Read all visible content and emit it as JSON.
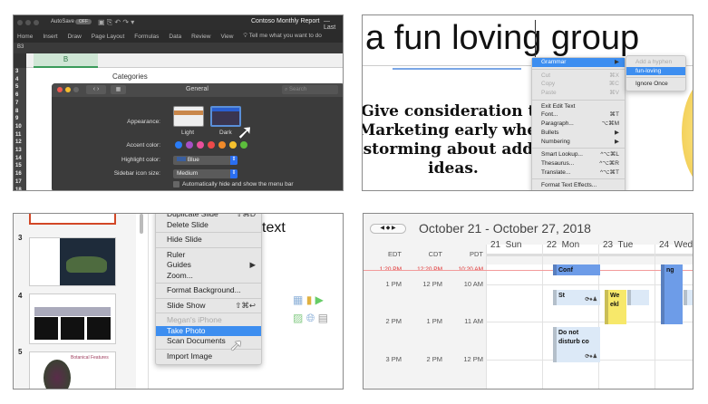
{
  "excel": {
    "autosave": "AutoSave",
    "autosave_state": "OFF",
    "doc_title": "Contoso Monthly Report",
    "last": "— Last",
    "tabs": [
      "Home",
      "Insert",
      "Draw",
      "Page Layout",
      "Formulas",
      "Data",
      "Review",
      "View"
    ],
    "tell_me": "Tell me what you want to do",
    "cell_ref": "B3",
    "column": "B",
    "rows": [
      "3",
      "4",
      "5",
      "6",
      "7",
      "8",
      "9",
      "10",
      "11",
      "12",
      "13",
      "14",
      "15",
      "16",
      "17",
      "18"
    ],
    "categories": "Categories"
  },
  "prefs": {
    "title": "General",
    "search_placeholder": "Search",
    "appearance_label": "Appearance:",
    "light": "Light",
    "dark": "Dark",
    "accent_label": "Accent color:",
    "accent_colors": [
      "#2a7cf6",
      "#a550c5",
      "#e8509b",
      "#ec4a4a",
      "#f08a2a",
      "#f5c02e",
      "#5cbd3c"
    ],
    "highlight_label": "Highlight color:",
    "highlight_value": "Blue",
    "sidebar_label": "Sidebar icon size:",
    "sidebar_value": "Medium",
    "menubar_option": "Automatically hide and show the menu bar"
  },
  "word": {
    "heading": "a fun loving group",
    "body_lines": [
      "Give consideration to",
      "Marketing early when",
      "brainstorming about additional",
      "ideas."
    ],
    "menu": [
      {
        "label": "Grammar",
        "shortcut": "▶",
        "state": "highlight"
      },
      {
        "sep": true
      },
      {
        "label": "Cut",
        "shortcut": "⌘X",
        "state": "disabled"
      },
      {
        "label": "Copy",
        "shortcut": "⌘C",
        "state": "disabled"
      },
      {
        "label": "Paste",
        "shortcut": "⌘V",
        "state": "disabled"
      },
      {
        "sep": true
      },
      {
        "label": "Exit Edit Text",
        "shortcut": ""
      },
      {
        "label": "Font...",
        "shortcut": "⌘T"
      },
      {
        "label": "Paragraph...",
        "shortcut": "⌥⌘M"
      },
      {
        "label": "Bullets",
        "shortcut": "▶"
      },
      {
        "label": "Numbering",
        "shortcut": "▶"
      },
      {
        "sep": true
      },
      {
        "label": "Smart Lookup...",
        "shortcut": "^⌥⌘L"
      },
      {
        "label": "Thesaurus...",
        "shortcut": "^⌥⌘R"
      },
      {
        "label": "Translate...",
        "shortcut": "^⌥⌘T"
      },
      {
        "sep": true
      },
      {
        "label": "Format Text Effects...",
        "shortcut": ""
      }
    ],
    "submenu": {
      "header": "Add a hyphen",
      "suggestion": "fun-loving",
      "ignore": "Ignore Once"
    }
  },
  "ppt": {
    "slide_numbers": [
      "3",
      "4",
      "5"
    ],
    "title_fragment": "text",
    "slide5_title": "Botanical Features",
    "menu": [
      {
        "label": "Duplicate Slide",
        "shortcut": "⇧⌘D"
      },
      {
        "label": "Delete Slide",
        "shortcut": ""
      },
      {
        "sep": true
      },
      {
        "label": "Hide Slide",
        "shortcut": ""
      },
      {
        "sep": true
      },
      {
        "label": "Ruler",
        "shortcut": ""
      },
      {
        "label": "Guides",
        "shortcut": "▶"
      },
      {
        "label": "Zoom...",
        "shortcut": ""
      },
      {
        "sep": true
      },
      {
        "label": "Format Background...",
        "shortcut": ""
      },
      {
        "sep": true
      },
      {
        "label": "Slide Show",
        "shortcut": "⇧⌘↩"
      },
      {
        "sep": true
      },
      {
        "label": "Megan's iPhone",
        "shortcut": "",
        "state": "disabled"
      },
      {
        "label": "Take Photo",
        "shortcut": "",
        "state": "highlight"
      },
      {
        "label": "Scan Documents",
        "shortcut": ""
      },
      {
        "sep": true
      },
      {
        "label": "Import Image",
        "shortcut": ""
      }
    ]
  },
  "calendar": {
    "title": "October 21 - October 27, 2018",
    "timezones": [
      "EDT",
      "CDT",
      "PDT"
    ],
    "days": [
      "21  Sun",
      "22  Mon",
      "23  Tue",
      "24  Wed"
    ],
    "times": [
      [
        "1 PM",
        "12 PM",
        "10 AM"
      ],
      [
        "2 PM",
        "1 PM",
        "11 AM"
      ],
      [
        "3 PM",
        "2 PM",
        "12 PM"
      ]
    ],
    "now": [
      "1:20 PM",
      "12:20 PM",
      "10:20 AM"
    ],
    "events": {
      "mon_top": "Conf",
      "mon_st": "St",
      "mon_dnd": "Do not disturb co",
      "tue_weekly": "We ekl",
      "wed_meeting": "ng"
    },
    "event_icons": "⟳♠♟"
  }
}
